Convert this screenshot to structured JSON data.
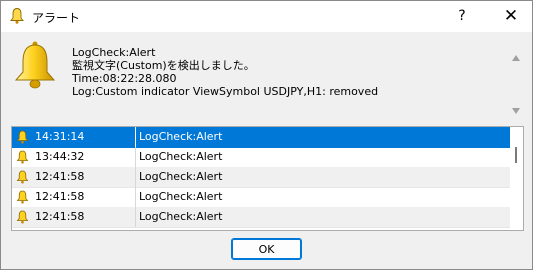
{
  "window": {
    "title": "アラート",
    "help_label": "?",
    "close_label": "✕"
  },
  "message": {
    "lines": [
      "LogCheck:Alert",
      "監視文字(Custom)を検出しました。",
      "Time:08:22:28.080",
      "Log:Custom indicator ViewSymbol USDJPY,H1: removed"
    ]
  },
  "alerts": [
    {
      "time": "14:31:14",
      "message": "LogCheck:Alert",
      "selected": true
    },
    {
      "time": "13:44:32",
      "message": "LogCheck:Alert"
    },
    {
      "time": "12:41:58",
      "message": "LogCheck:Alert"
    },
    {
      "time": "12:41:58",
      "message": "LogCheck:Alert"
    },
    {
      "time": "12:41:58",
      "message": "LogCheck:Alert"
    }
  ],
  "buttons": {
    "ok_label": "OK"
  },
  "colors": {
    "selection": "#0078d7",
    "bell": "#f2c200"
  },
  "icons": {
    "title": "bell-icon",
    "message": "bell-icon",
    "row": "bell-icon"
  }
}
